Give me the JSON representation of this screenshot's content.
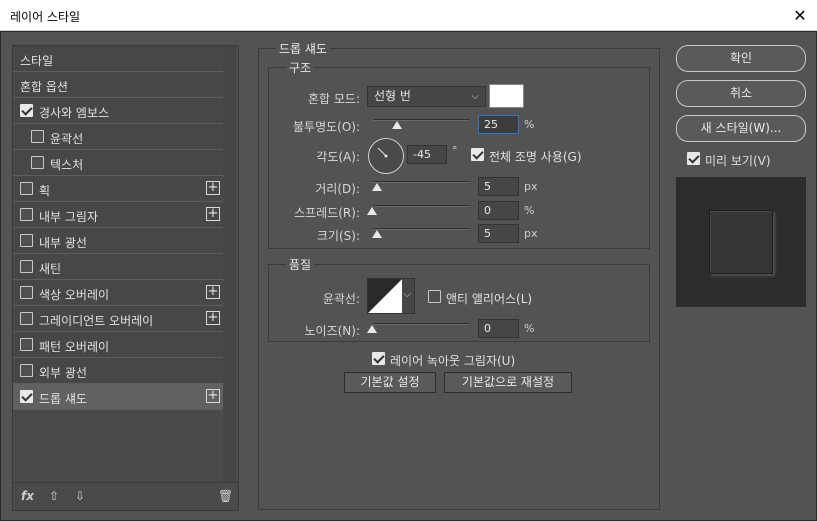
{
  "window": {
    "title": "레이어 스타일",
    "close": "✕"
  },
  "styles_list": [
    {
      "label": "스타일",
      "checkbox": false,
      "plus": false,
      "indent": false,
      "active": false
    },
    {
      "label": "혼합 옵션",
      "checkbox": false,
      "plus": false,
      "indent": false,
      "active": false
    },
    {
      "label": "경사와 엠보스",
      "checkbox": true,
      "checked": true,
      "plus": false,
      "indent": false,
      "active": false
    },
    {
      "label": "윤곽선",
      "checkbox": true,
      "checked": false,
      "plus": false,
      "indent": true,
      "active": false
    },
    {
      "label": "텍스처",
      "checkbox": true,
      "checked": false,
      "plus": false,
      "indent": true,
      "active": false
    },
    {
      "label": "획",
      "checkbox": true,
      "checked": false,
      "plus": true,
      "indent": false,
      "active": false
    },
    {
      "label": "내부 그림자",
      "checkbox": true,
      "checked": false,
      "plus": true,
      "indent": false,
      "active": false
    },
    {
      "label": "내부 광선",
      "checkbox": true,
      "checked": false,
      "plus": false,
      "indent": false,
      "active": false
    },
    {
      "label": "새틴",
      "checkbox": true,
      "checked": false,
      "plus": false,
      "indent": false,
      "active": false
    },
    {
      "label": "색상 오버레이",
      "checkbox": true,
      "checked": false,
      "plus": true,
      "indent": false,
      "active": false
    },
    {
      "label": "그레이디언트 오버레이",
      "checkbox": true,
      "checked": false,
      "plus": true,
      "indent": false,
      "active": false
    },
    {
      "label": "패턴 오버레이",
      "checkbox": true,
      "checked": false,
      "plus": false,
      "indent": false,
      "active": false
    },
    {
      "label": "외부 광선",
      "checkbox": true,
      "checked": false,
      "plus": false,
      "indent": false,
      "active": false
    },
    {
      "label": "드롭 섀도",
      "checkbox": true,
      "checked": true,
      "plus": true,
      "indent": false,
      "active": true
    }
  ],
  "bottom_toolbar": {
    "fx": "fx",
    "up": "⇧",
    "down": "⇩",
    "trash": "🗑"
  },
  "drop_shadow": {
    "section_title": "드롭 섀도",
    "structure": {
      "title": "구조",
      "blend_mode_label": "혼합 모드:",
      "blend_mode_value": "선형 번",
      "blend_color": "#ffffff",
      "opacity_label": "불투명도(O):",
      "opacity_value": "25",
      "opacity_unit": "%",
      "angle_label": "각도(A):",
      "angle_value": "-45",
      "angle_unit": "°",
      "global_light_label": "전체 조명 사용(G)",
      "global_light_checked": true,
      "distance_label": "거리(D):",
      "distance_value": "5",
      "distance_unit": "px",
      "spread_label": "스프레드(R):",
      "spread_value": "0",
      "spread_unit": "%",
      "size_label": "크기(S):",
      "size_value": "5",
      "size_unit": "px"
    },
    "quality": {
      "title": "품질",
      "contour_label": "윤곽선:",
      "anti_alias_label": "앤티 앨리어스(L)",
      "anti_alias_checked": false,
      "noise_label": "노이즈(N):",
      "noise_value": "0",
      "noise_unit": "%"
    },
    "knockout_label": "레이어 녹아웃 그림자(U)",
    "knockout_checked": true,
    "make_default": "기본값 설정",
    "reset_default": "기본값으로 재설정"
  },
  "right": {
    "ok": "확인",
    "cancel": "취소",
    "new_style": "새 스타일(W)...",
    "preview_label": "미리 보기(V)",
    "preview_checked": true
  }
}
